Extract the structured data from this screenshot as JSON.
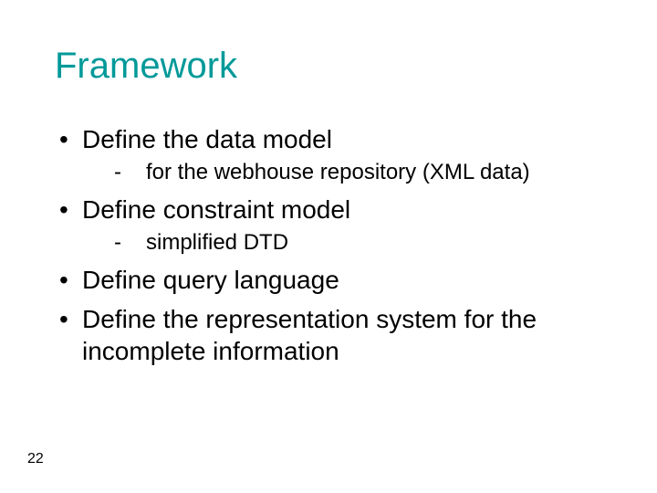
{
  "title": "Framework",
  "bullets": [
    {
      "text": "Define the data model",
      "sub": [
        "for the webhouse repository (XML data)"
      ]
    },
    {
      "text": "Define constraint model",
      "sub": [
        "simplified DTD"
      ]
    },
    {
      "text": "Define query language",
      "sub": []
    },
    {
      "text": "Define the representation system for the incomplete information",
      "sub": []
    }
  ],
  "page_number": "22"
}
